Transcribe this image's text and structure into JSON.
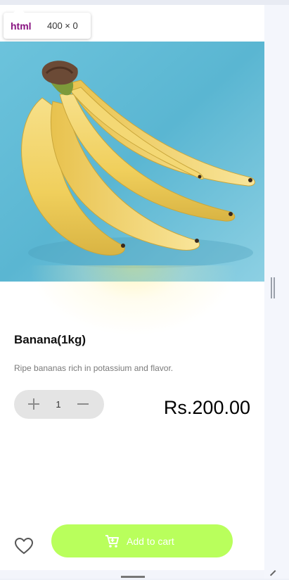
{
  "inspector": {
    "tag": "html",
    "size": "400 × 0"
  },
  "product": {
    "image_name": "banana-bunch-photo",
    "title": "Banana(1kg)",
    "description": "Ripe bananas rich in potassium and flavor.",
    "quantity": "1",
    "price": "Rs.200.00"
  },
  "actions": {
    "add_to_cart_label": "Add to cart",
    "favorite_icon": "heart-icon",
    "cart_icon": "cart-icon"
  },
  "colors": {
    "accent_button": "#b9ff5c",
    "quantity_bg": "#e4e4e4",
    "image_background": "#57b9d6",
    "banana_yellow": "#f2d46b"
  }
}
